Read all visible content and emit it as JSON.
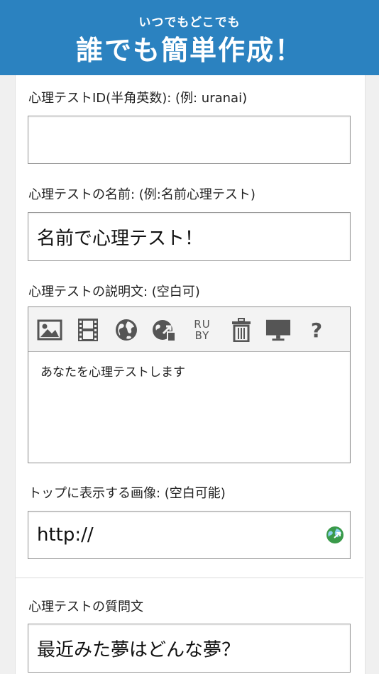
{
  "banner": {
    "subtitle": "いつでもどこでも",
    "title": "誰でも簡単作成！"
  },
  "form": {
    "id_field": {
      "label": "心理テストID(半角英数): (例: uranai)",
      "value": ""
    },
    "name_field": {
      "label": "心理テストの名前: (例:名前心理テスト)",
      "value": "名前で心理テスト！"
    },
    "description": {
      "label": "心理テストの説明文: (空白可)",
      "text": "あなたを心理テストします",
      "toolbar": [
        {
          "name": "image-icon"
        },
        {
          "name": "film-icon"
        },
        {
          "name": "globe-icon"
        },
        {
          "name": "link-icon"
        },
        {
          "name": "ruby-icon",
          "label_top": "RU",
          "label_bottom": "BY"
        },
        {
          "name": "trash-icon"
        },
        {
          "name": "monitor-icon"
        },
        {
          "name": "help-icon",
          "label": "?"
        }
      ]
    },
    "top_image": {
      "label": "トップに表示する画像: (空白可能)",
      "value": "http://"
    },
    "question": {
      "label": "心理テストの質問文",
      "value": "最近みた夢はどんな夢？"
    }
  }
}
